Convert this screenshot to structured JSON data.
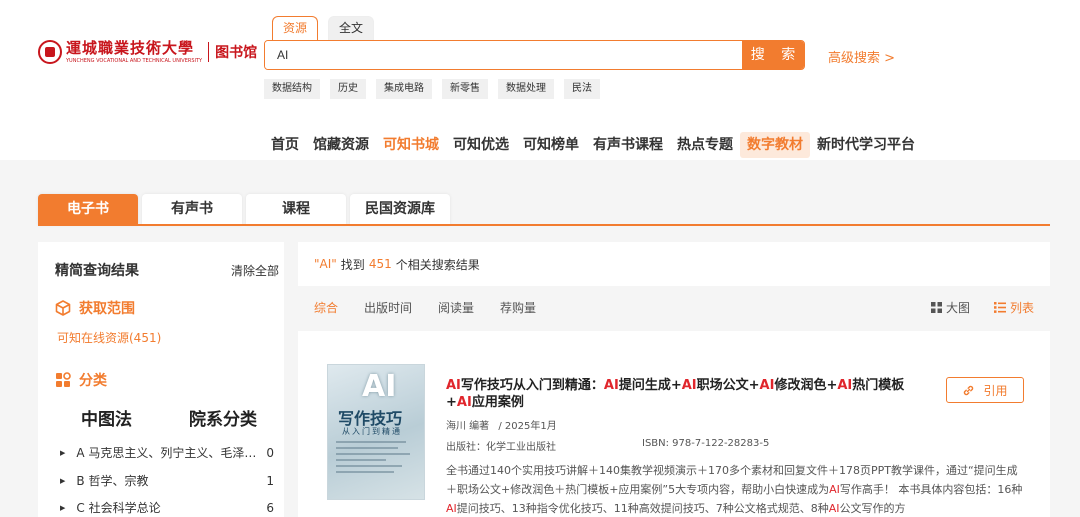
{
  "brand": {
    "name_cn": "運城職業技術大學",
    "name_en": "YUNCHENG VOCATIONAL AND TECHNICAL UNIVERSITY",
    "library": "图书馆",
    "color": "#c8161d"
  },
  "accent": "#f27c2f",
  "search": {
    "tabs": [
      {
        "label": "资源",
        "active": true
      },
      {
        "label": "全文",
        "active": false
      }
    ],
    "value": "AI",
    "button": "搜 索",
    "advanced": "高级搜索 >",
    "hot_tags": [
      "数据结构",
      "历史",
      "集成电路",
      "新零售",
      "数据处理",
      "民法"
    ]
  },
  "nav": [
    {
      "label": "首页",
      "state": "normal"
    },
    {
      "label": "馆藏资源",
      "state": "normal"
    },
    {
      "label": "可知书城",
      "state": "active"
    },
    {
      "label": "可知优选",
      "state": "normal"
    },
    {
      "label": "可知榜单",
      "state": "normal"
    },
    {
      "label": "有声书课程",
      "state": "normal"
    },
    {
      "label": "热点专题",
      "state": "normal"
    },
    {
      "label": "数字教材",
      "state": "highlight"
    },
    {
      "label": "新时代学习平台",
      "state": "normal"
    }
  ],
  "resource_tabs": [
    {
      "label": "电子书",
      "active": true
    },
    {
      "label": "有声书",
      "active": false
    },
    {
      "label": "课程",
      "active": false
    },
    {
      "label": "民国资源库",
      "active": false
    }
  ],
  "sidebar": {
    "title": "精简查询结果",
    "clear": "清除全部",
    "scope_title": "获取范围",
    "scope_item": "可知在线资源(451)",
    "category_title": "分类",
    "class_tabs": [
      "中图法",
      "院系分类"
    ],
    "items": [
      {
        "label": "A 马克思主义、列宁主义、毛泽东...",
        "count": "0"
      },
      {
        "label": "B 哲学、宗教",
        "count": "1"
      },
      {
        "label": "C 社会科学总论",
        "count": "6"
      }
    ]
  },
  "results_info": {
    "query": "\"AI\"",
    "found": "找到",
    "count": "451",
    "suffix": "个相关搜索结果"
  },
  "sort": {
    "options": [
      "综合",
      "出版时间",
      "阅读量",
      "荐购量"
    ],
    "active": "综合",
    "views": [
      {
        "label": "大图",
        "icon": "grid-icon",
        "active": false
      },
      {
        "label": "列表",
        "icon": "list-icon",
        "active": true
      }
    ]
  },
  "result": {
    "title_parts": [
      {
        "t": "AI",
        "hl": true
      },
      {
        "t": "写作技巧从入门到精通：",
        "hl": false
      },
      {
        "t": "AI",
        "hl": true
      },
      {
        "t": "提问生成+",
        "hl": false
      },
      {
        "t": "AI",
        "hl": true
      },
      {
        "t": "职场公文+",
        "hl": false
      },
      {
        "t": "AI",
        "hl": true
      },
      {
        "t": "修改润色+",
        "hl": false
      },
      {
        "t": "AI",
        "hl": true
      },
      {
        "t": "热门模板+",
        "hl": false
      },
      {
        "t": "AI",
        "hl": true
      },
      {
        "t": "应用案例",
        "hl": false
      }
    ],
    "author": "海川 编著",
    "date": "/ 2025年1月",
    "publisher": "出版社：化学工业出版社",
    "isbn": "ISBN: 978-7-122-28283-5",
    "desc_parts": [
      {
        "t": "全书通过140个实用技巧讲解＋140集教学视频演示＋170多个素材和回复文件＋178页PPT教学课件，通过“提问生成＋职场公文+修改润色＋热门模板+应用案例”5大专项内容，帮助小白快速成为",
        "hl": false
      },
      {
        "t": "AI",
        "hl": true
      },
      {
        "t": "写作高手！ 本书具体内容包括：16种",
        "hl": false
      },
      {
        "t": "AI",
        "hl": true
      },
      {
        "t": "提问技巧、13种指令优化技巧、11种高效提问技巧、7种公文格式规范、8种",
        "hl": false
      },
      {
        "t": "AI",
        "hl": true
      },
      {
        "t": "公文写作的方",
        "hl": false
      }
    ],
    "cite": "引用",
    "cover": {
      "big": "AI",
      "title": "写作技巧",
      "subtitle": "从入门到精通"
    }
  }
}
